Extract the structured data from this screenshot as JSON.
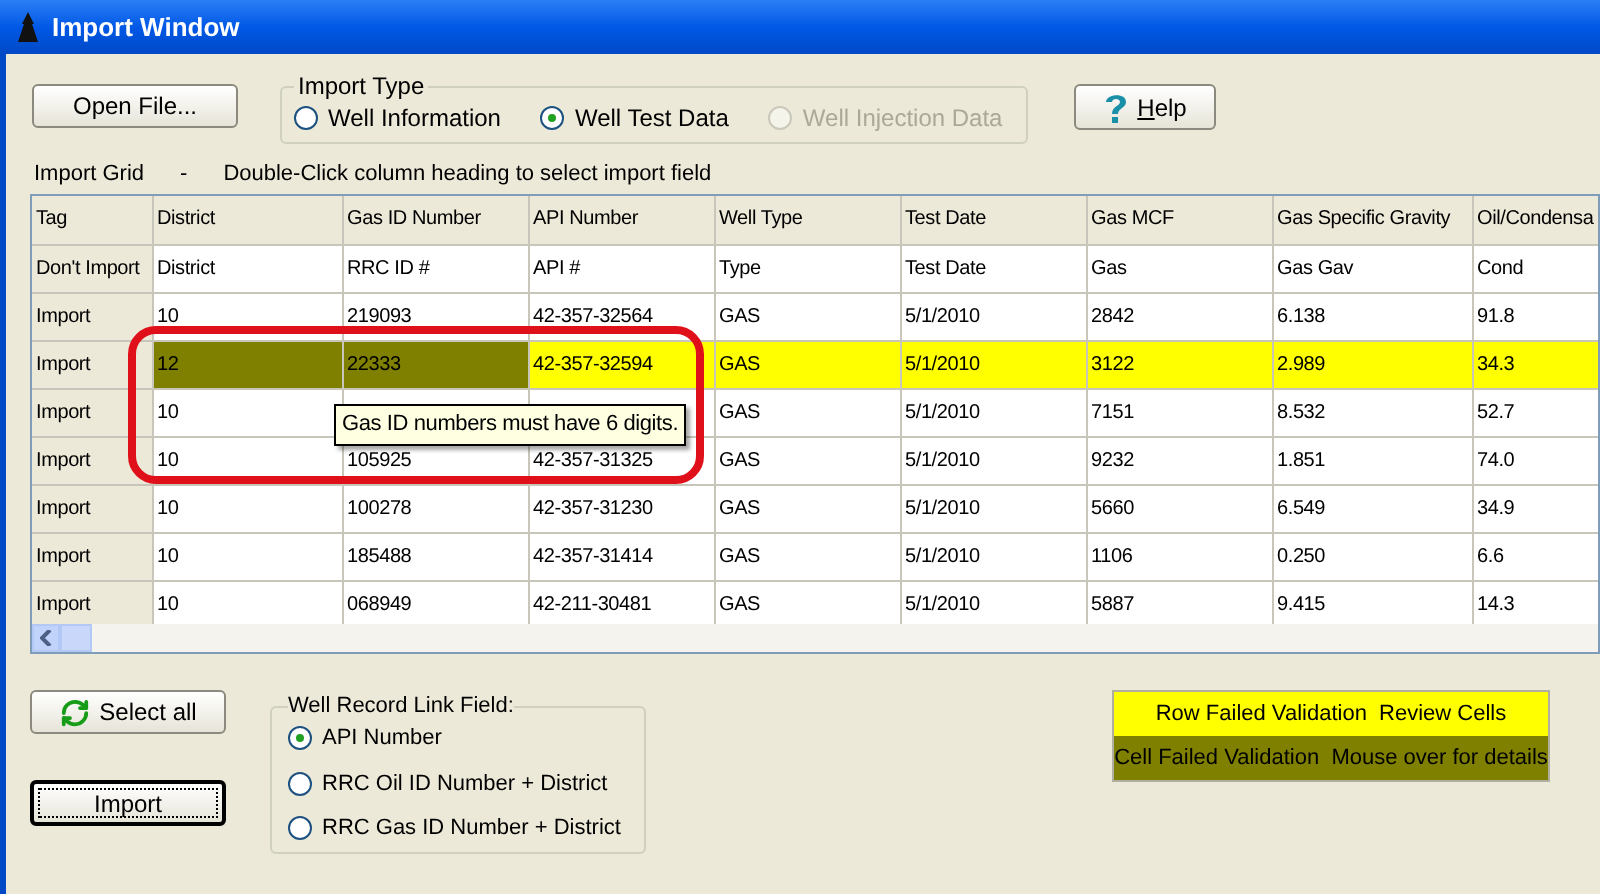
{
  "window": {
    "title": "Import Window"
  },
  "open_file_button": "Open File...",
  "import_type": {
    "label": "Import Type",
    "options": [
      {
        "label": "Well Information",
        "selected": false,
        "disabled": false
      },
      {
        "label": "Well Test Data",
        "selected": true,
        "disabled": false
      },
      {
        "label": "Well Injection Data",
        "selected": false,
        "disabled": true
      }
    ]
  },
  "help_button": "Help",
  "grid_caption": {
    "title": "Import Grid",
    "separator": "-",
    "hint": "Double-Click column heading to select import field"
  },
  "table": {
    "columns": [
      "Tag",
      "District",
      "Gas ID Number",
      "API Number",
      "Well Type",
      "Test Date",
      "Gas MCF",
      "Gas Specific Gravity",
      "Oil/Condensa"
    ],
    "mapping_row": [
      "Don't Import",
      "District",
      "RRC ID #",
      "API #",
      "Type",
      "Test Date",
      "Gas",
      "Gas Gav",
      "Cond"
    ],
    "rows": [
      {
        "failed": false,
        "cells": [
          {
            "text": "Import",
            "failed": false
          },
          {
            "text": "10",
            "failed": false
          },
          {
            "text": "219093",
            "failed": false
          },
          {
            "text": "42-357-32564",
            "failed": false
          },
          {
            "text": "GAS",
            "failed": false
          },
          {
            "text": "5/1/2010",
            "failed": false
          },
          {
            "text": "2842",
            "failed": false
          },
          {
            "text": "6.138",
            "failed": false
          },
          {
            "text": "91.8",
            "failed": false
          }
        ]
      },
      {
        "failed": true,
        "cells": [
          {
            "text": "Import",
            "failed": false
          },
          {
            "text": "12",
            "failed": true
          },
          {
            "text": "22333",
            "failed": true
          },
          {
            "text": "42-357-32594",
            "failed": false
          },
          {
            "text": "GAS",
            "failed": false
          },
          {
            "text": "5/1/2010",
            "failed": false
          },
          {
            "text": "3122",
            "failed": false
          },
          {
            "text": "2.989",
            "failed": false
          },
          {
            "text": "34.3",
            "failed": false
          }
        ]
      },
      {
        "failed": false,
        "cells": [
          {
            "text": "Import",
            "failed": false
          },
          {
            "text": "10",
            "failed": false
          },
          {
            "failed": false
          },
          {
            "failed": false
          },
          {
            "text": "GAS",
            "failed": false
          },
          {
            "text": "5/1/2010",
            "failed": false
          },
          {
            "text": "7151",
            "failed": false
          },
          {
            "text": "8.532",
            "failed": false
          },
          {
            "text": "52.7",
            "failed": false
          }
        ]
      },
      {
        "failed": false,
        "cells": [
          {
            "text": "Import",
            "failed": false
          },
          {
            "text": "10",
            "failed": false
          },
          {
            "text": "105925",
            "failed": false
          },
          {
            "text": "42-357-31325",
            "failed": false
          },
          {
            "text": "GAS",
            "failed": false
          },
          {
            "text": "5/1/2010",
            "failed": false
          },
          {
            "text": "9232",
            "failed": false
          },
          {
            "text": "1.851",
            "failed": false
          },
          {
            "text": "74.0",
            "failed": false
          }
        ]
      },
      {
        "failed": false,
        "cells": [
          {
            "text": "Import",
            "failed": false
          },
          {
            "text": "10",
            "failed": false
          },
          {
            "text": "100278",
            "failed": false
          },
          {
            "text": "42-357-31230",
            "failed": false
          },
          {
            "text": "GAS",
            "failed": false
          },
          {
            "text": "5/1/2010",
            "failed": false
          },
          {
            "text": "5660",
            "failed": false
          },
          {
            "text": "6.549",
            "failed": false
          },
          {
            "text": "34.9",
            "failed": false
          }
        ]
      },
      {
        "failed": false,
        "cells": [
          {
            "text": "Import",
            "failed": false
          },
          {
            "text": "10",
            "failed": false
          },
          {
            "text": "185488",
            "failed": false
          },
          {
            "text": "42-357-31414",
            "failed": false
          },
          {
            "text": "GAS",
            "failed": false
          },
          {
            "text": "5/1/2010",
            "failed": false
          },
          {
            "text": "1106",
            "failed": false
          },
          {
            "text": "0.250",
            "failed": false
          },
          {
            "text": "6.6",
            "failed": false
          }
        ]
      },
      {
        "failed": false,
        "cells": [
          {
            "text": "Import",
            "failed": false
          },
          {
            "text": "10",
            "failed": false
          },
          {
            "text": "068949",
            "failed": false
          },
          {
            "text": "42-211-30481",
            "failed": false
          },
          {
            "text": "GAS",
            "failed": false
          },
          {
            "text": "5/1/2010",
            "failed": false
          },
          {
            "text": "5887",
            "failed": false
          },
          {
            "text": "9.415",
            "failed": false
          },
          {
            "text": "14.3",
            "failed": false
          }
        ]
      }
    ]
  },
  "tooltip": "Gas ID numbers must have 6 digits.",
  "select_all_button": "Select all",
  "import_button": "Import",
  "link_field": {
    "label": "Well Record Link Field:",
    "options": [
      {
        "label": "API Number",
        "selected": true
      },
      {
        "label": "RRC Oil ID Number + District",
        "selected": false
      },
      {
        "label": "RRC Gas ID Number + District",
        "selected": false
      }
    ]
  },
  "legend": [
    {
      "kind": "row",
      "label": "Row Failed Validation  Review Cells"
    },
    {
      "kind": "cell",
      "label": "Cell Failed Validation  Mouse over for details"
    }
  ]
}
